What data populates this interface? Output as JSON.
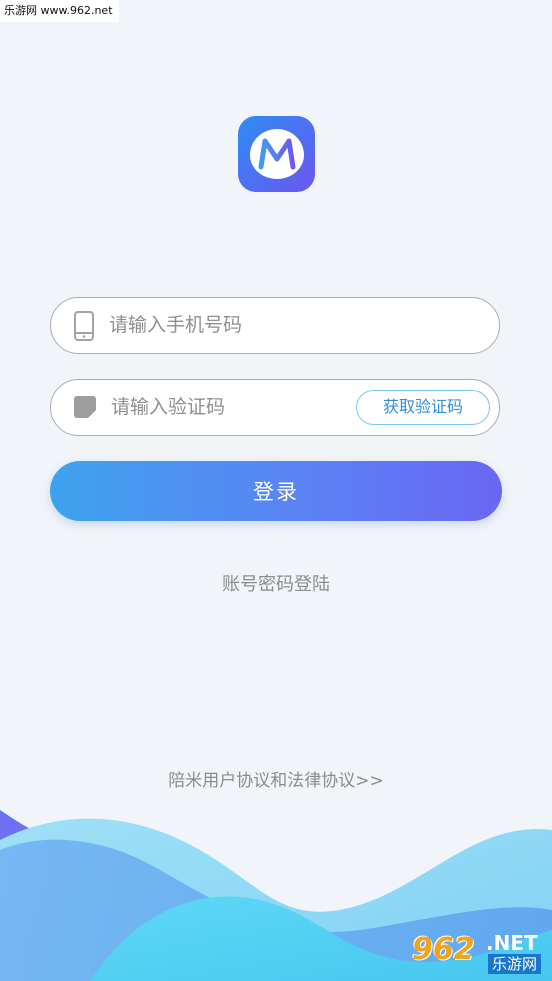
{
  "watermark_top": "乐游网 www.962.net",
  "logo": {
    "letter": "M"
  },
  "phone_field": {
    "placeholder": "请输入手机号码",
    "value": "",
    "icon": "phone-icon"
  },
  "code_field": {
    "placeholder": "请输入验证码",
    "value": "",
    "icon": "image-code-icon",
    "button_label": "获取验证码"
  },
  "login_button": "登录",
  "password_login_link": "账号密码登陆",
  "agreement_link": "陪米用户协议和法律协议>>",
  "watermark_bottom": {
    "number": "962",
    "domain": ".NET",
    "name": "乐游网"
  },
  "colors": {
    "background": "#f1f5f9",
    "accent_start": "#3ea3ee",
    "accent_end": "#6a66f5",
    "code_button_text": "#2f8fdb",
    "muted_text": "#8b8b8b"
  }
}
